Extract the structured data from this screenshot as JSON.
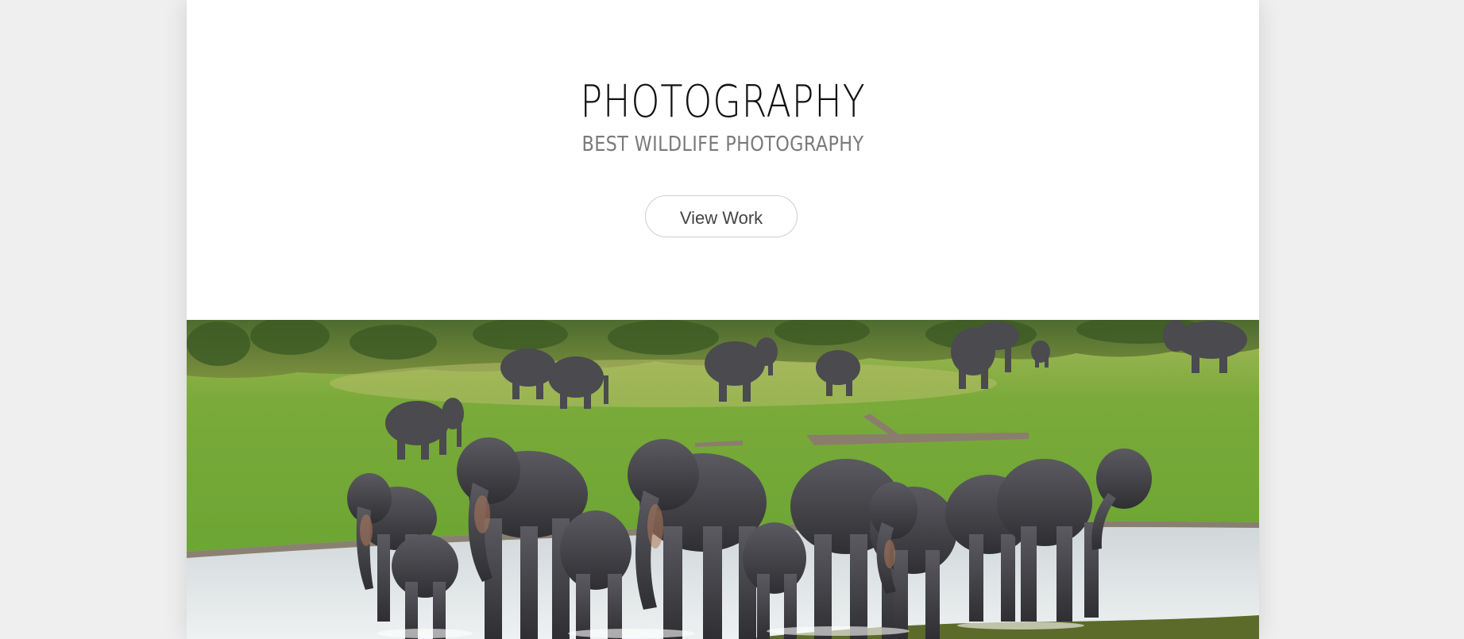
{
  "hero": {
    "title": "PHOTOGRAPHY",
    "subtitle": "BEST WILDLIFE PHOTOGRAPHY",
    "button_label": "View Work"
  },
  "colors": {
    "background": "#efefef",
    "card": "#ffffff",
    "title": "#111111",
    "subtitle": "#7a7a7a",
    "button_border": "#cfcfcf",
    "grass": "#6ba131",
    "forest": "#3f6a28",
    "water": "#d9dee0",
    "elephant": "#3e3e42"
  },
  "image": {
    "subject": "elephant-herd-at-waterhole"
  }
}
